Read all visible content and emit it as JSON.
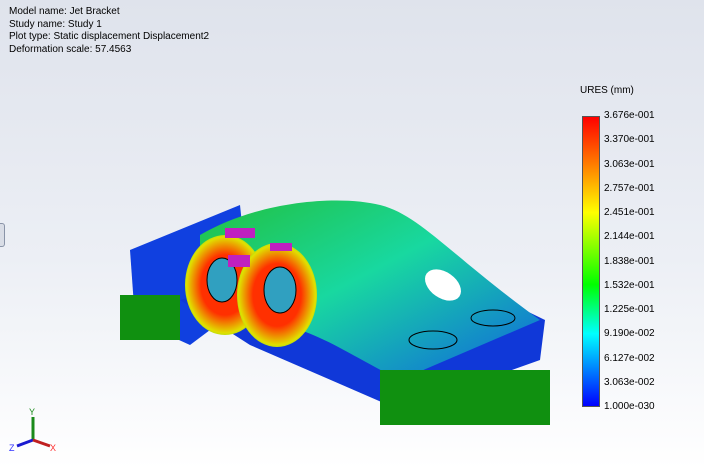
{
  "info": {
    "model_name": "Model name: Jet Bracket",
    "study_name": "Study name: Study 1",
    "plot_type": "Plot type: Static displacement Displacement2",
    "deformation_scale": "Deformation scale: 57.4563"
  },
  "legend": {
    "title": "URES (mm)",
    "labels": [
      "3.676e-001",
      "3.370e-001",
      "3.063e-001",
      "2.757e-001",
      "2.451e-001",
      "2.144e-001",
      "1.838e-001",
      "1.532e-001",
      "1.225e-001",
      "9.190e-002",
      "6.127e-002",
      "3.063e-002",
      "1.000e-030"
    ],
    "colors": {
      "max": "#ff0000",
      "mid": "#00ff00",
      "min": "#0000ff"
    }
  },
  "triad": {
    "x": "X",
    "y": "Y",
    "z": "Z"
  }
}
